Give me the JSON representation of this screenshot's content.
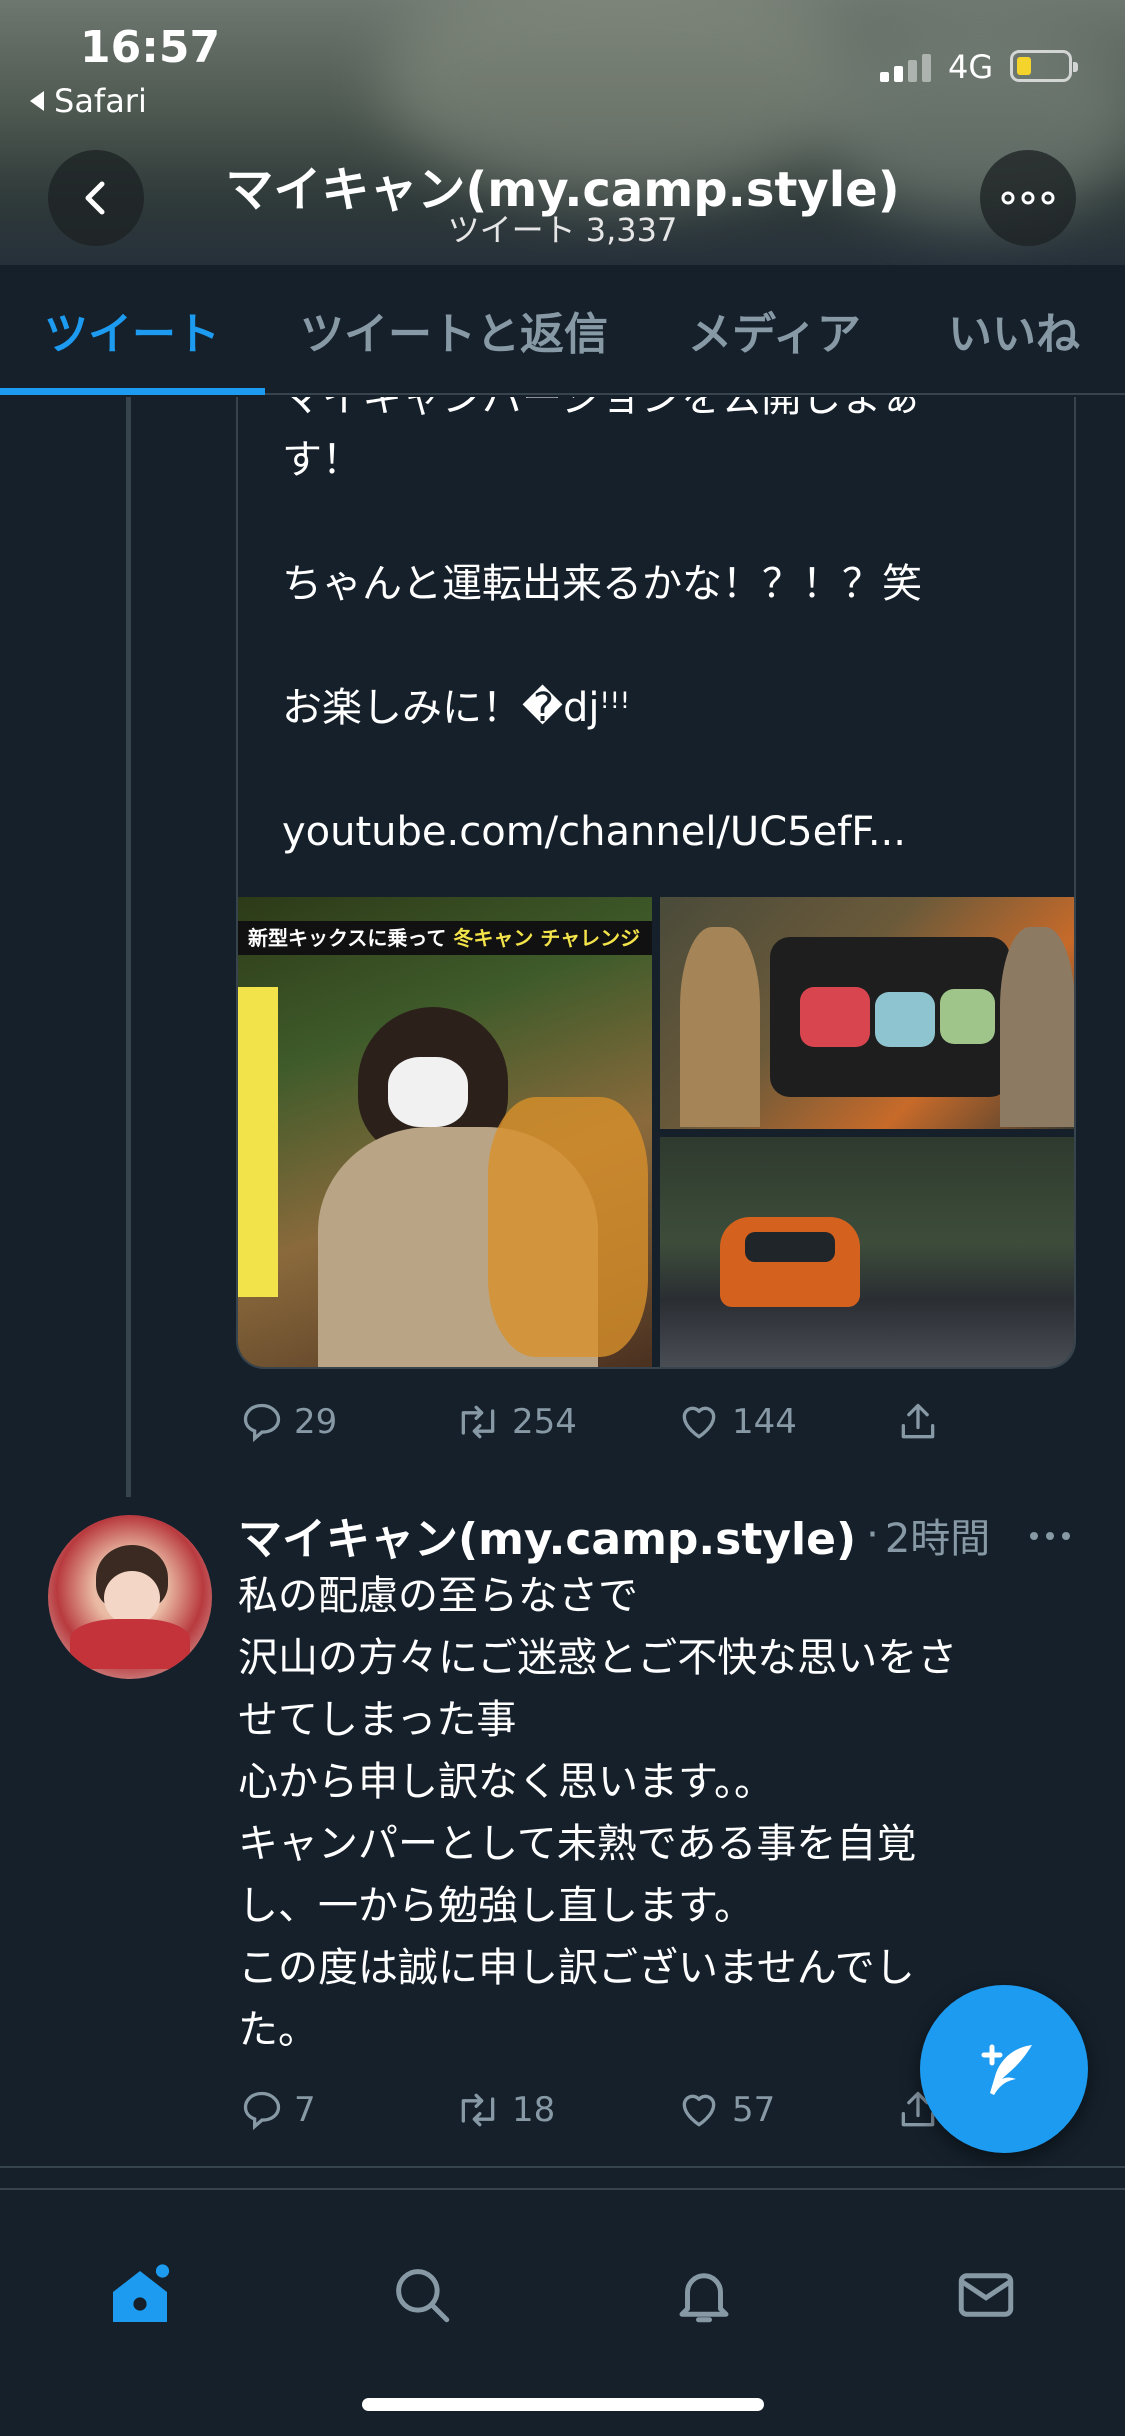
{
  "status_bar": {
    "time": "16:57",
    "back_app": "Safari",
    "network": "4G",
    "battery_color": "#f4d32b"
  },
  "profile_header": {
    "name": "マイキャン(my.camp.style)",
    "tweet_count": "ツイート 3,337"
  },
  "tabs": [
    {
      "label": "ツイート",
      "active": true
    },
    {
      "label": "ツイートと返信",
      "active": false
    },
    {
      "label": "メディア",
      "active": false
    },
    {
      "label": "いいね",
      "active": false
    }
  ],
  "quoted_tweet": {
    "lines": [
      "マイキャンバージョンを公開しまぁ",
      "す！",
      "",
      "ちゃんと運転出来るかな！？！？笑",
      "",
      "お楽しみに！�djꜝꜝꜝ",
      "",
      "youtube.com/channel/UC5efF..."
    ],
    "image_banner": {
      "prefix": "新型キックスに乗って",
      "highlight": "冬キャン",
      "suffix": "チャレンジ"
    },
    "actions": {
      "reply": "29",
      "retweet": "254",
      "like": "144"
    }
  },
  "tweet": {
    "name": "マイキャン(my.camp.style)",
    "separator": "·",
    "time": "2時間",
    "body_lines": [
      "私の配慮の至らなさで",
      "沢山の方々にご迷惑とご不快な思いをさ",
      "せてしまった事",
      "心から申し訳なく思います。。",
      "キャンパーとして未熟である事を自覚",
      "し、一から勉強し直します。",
      "この度は誠に申し訳ございませんでし",
      "た。"
    ],
    "actions": {
      "reply": "7",
      "retweet": "18",
      "like": "57"
    }
  },
  "colors": {
    "background": "#15202b",
    "accent": "#1d9bf0",
    "muted": "#8899a6",
    "border": "#38444d"
  },
  "icons": {
    "back": "chevron-left-icon",
    "more": "more-horizontal-icon",
    "reply": "reply-icon",
    "retweet": "retweet-icon",
    "like": "heart-icon",
    "share": "share-icon",
    "compose": "compose-tweet-icon",
    "nav_home": "home-icon",
    "nav_search": "search-icon",
    "nav_notifications": "bell-icon",
    "nav_messages": "mail-icon"
  }
}
